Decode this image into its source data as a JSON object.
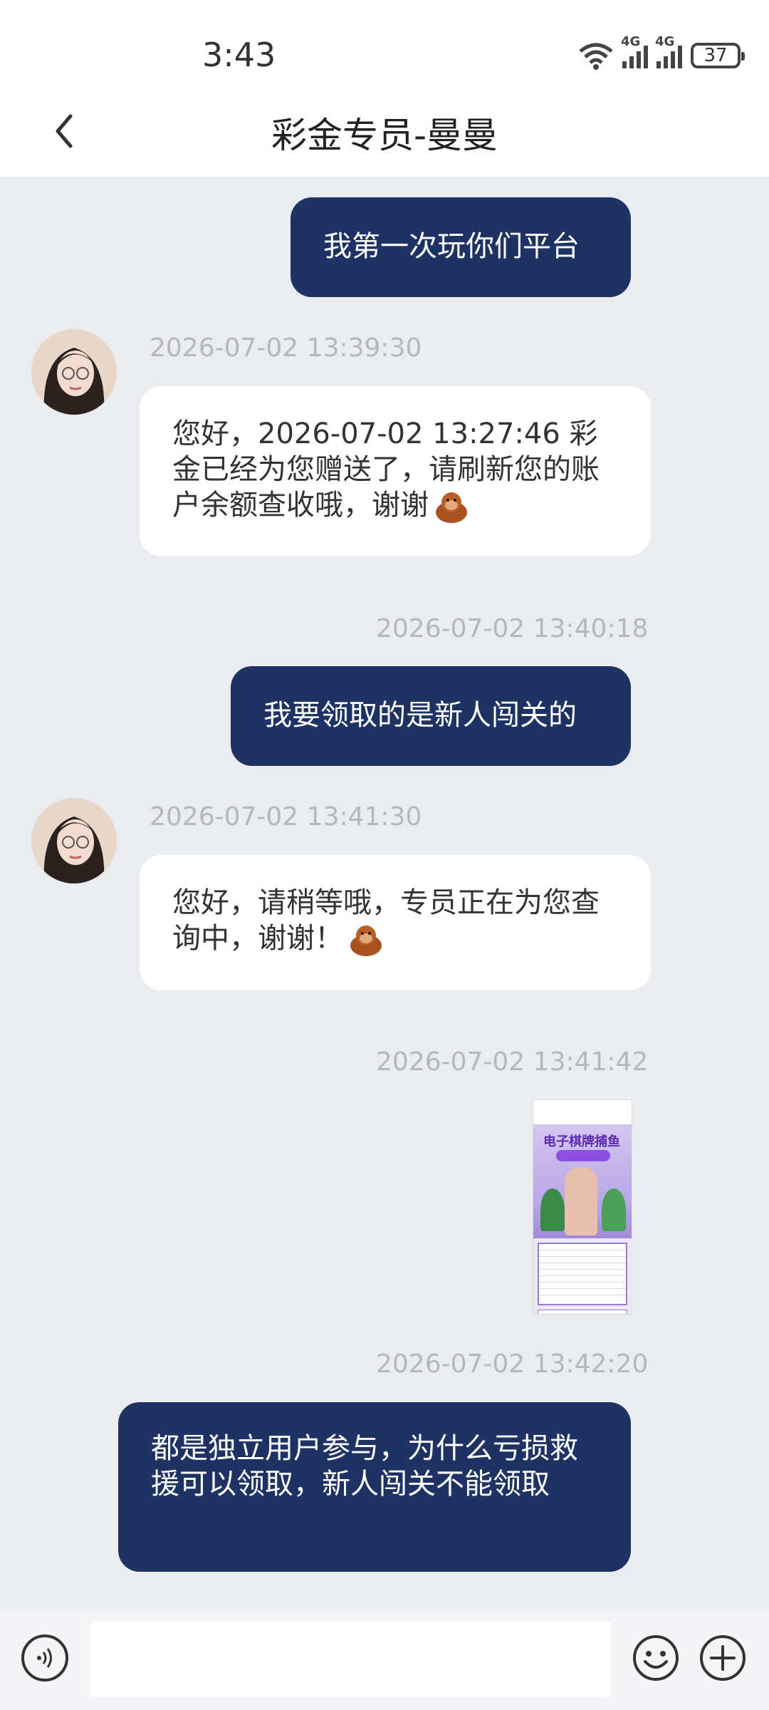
{
  "status_bar": {
    "time": "3:43",
    "network_label_1": "4G",
    "network_label_2": "4G",
    "battery": "37"
  },
  "header": {
    "title": "彩金专员-曼曼"
  },
  "messages": {
    "m1": {
      "text": "我第一次玩你们平台"
    },
    "m2": {
      "timestamp": "2026-07-02 13:39:30",
      "text": "您好，2026-07-02 13:27:46 彩金已经为您赠送了，请刷新您的账户余额查收哦，谢谢"
    },
    "m3": {
      "timestamp": "2026-07-02 13:40:18",
      "text": "我要领取的是新人闯关的"
    },
    "m4": {
      "timestamp": "2026-07-02 13:41:30",
      "text": "您好，请稍等哦，专员正在为您查询中，谢谢！"
    },
    "m5": {
      "timestamp": "2026-07-02 13:41:42",
      "image_title": "电子棋牌捕鱼"
    },
    "m6": {
      "timestamp": "2026-07-02 13:42:20",
      "text": "都是独立用户参与，为什么亏损救援可以领取，新人闯关不能领取"
    }
  },
  "colors": {
    "outgoing_bubble": "#1e3264",
    "incoming_bubble": "#ffffff",
    "background": "#ebecf0",
    "timestamp": "#b5b7bd"
  },
  "icons": {
    "back": "chevron-left-icon",
    "voice": "voice-icon",
    "emoji": "emoji-icon",
    "plus": "plus-icon",
    "sticker": "orangutan-emoji"
  }
}
